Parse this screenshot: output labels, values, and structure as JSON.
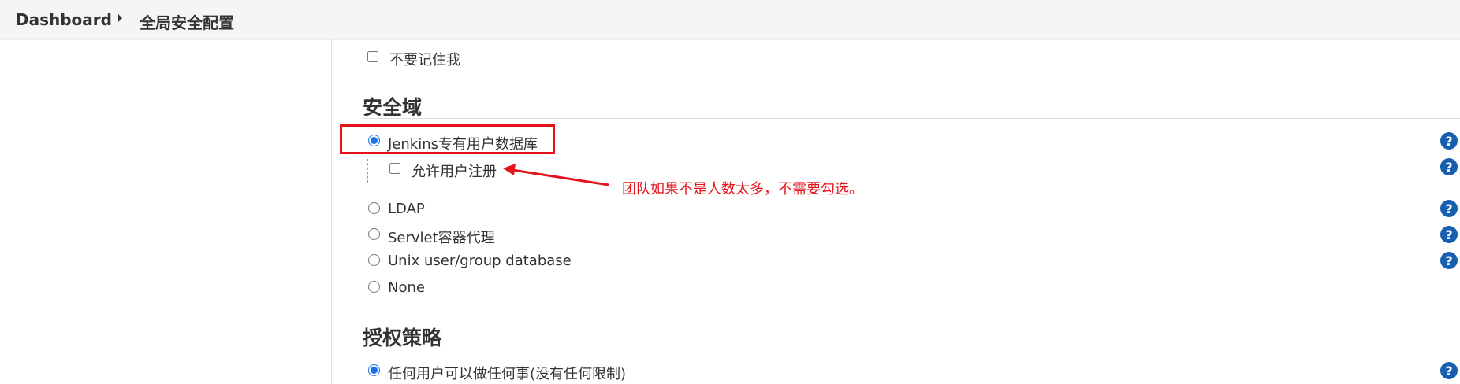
{
  "breadcrumb": {
    "items": [
      "Dashboard",
      "全局安全配置"
    ]
  },
  "remember_me": {
    "label": "不要记住我",
    "checked": false
  },
  "security_realm": {
    "title": "安全域",
    "options": [
      {
        "label": "Jenkins专有用户数据库",
        "selected": true
      },
      {
        "label": "LDAP",
        "selected": false
      },
      {
        "label": "Servlet容器代理",
        "selected": false
      },
      {
        "label": "Unix user/group database",
        "selected": false
      },
      {
        "label": "None",
        "selected": false
      }
    ],
    "allow_signup": {
      "label": "允许用户注册",
      "checked": false
    }
  },
  "annotation": {
    "text": "团队如果不是人数太多，不需要勾选。",
    "color": "#e5141c"
  },
  "authorization": {
    "title": "授权策略",
    "options": [
      {
        "label": "任何用户可以做任何事(没有任何限制)",
        "selected": true
      }
    ]
  },
  "help_icon": {
    "glyph": "?",
    "icon": "question-circle-icon",
    "color": "#175fb0"
  }
}
